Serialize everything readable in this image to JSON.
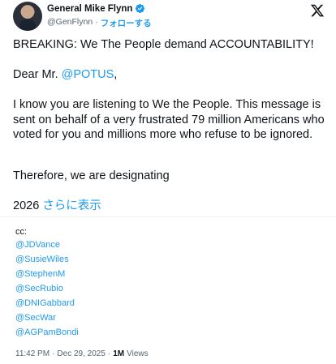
{
  "header": {
    "display_name": "General Mike Flynn",
    "handle": "@GenFlynn",
    "separator": "·",
    "follow_label": "フォローする",
    "verified_icon": "verified-badge-icon",
    "platform_icon": "x-logo-icon"
  },
  "tweet": {
    "line1": "BREAKING: We The People demand ACCOUNTABILITY!",
    "greeting_prefix": "Dear Mr. ",
    "greeting_mention": "@POTUS",
    "greeting_suffix": ",",
    "paragraph": "I know you are listening to We the People. This message is sent on behalf of a very frustrated 79 million Americans who voted for you and millions more who refuse to be ignored.",
    "line4": "Therefore, we are designating",
    "line5_prefix": "2026 ",
    "show_more": "さらに表示"
  },
  "reply": {
    "cc_label": "cc:",
    "mentions": [
      "@JDVance",
      "@SusieWiles",
      "@StephenM",
      "@SecRubio",
      "@DNIGabbard",
      "@SecWar",
      "@AGPamBondi"
    ],
    "time": "11:42 PM",
    "sep1": "·",
    "date": "Dec 29, 2025",
    "sep2": "·",
    "views_count": "1M",
    "views_label": "Views"
  },
  "colors": {
    "accent": "#1d9bf0",
    "text": "#0f1419",
    "muted": "#536471"
  }
}
